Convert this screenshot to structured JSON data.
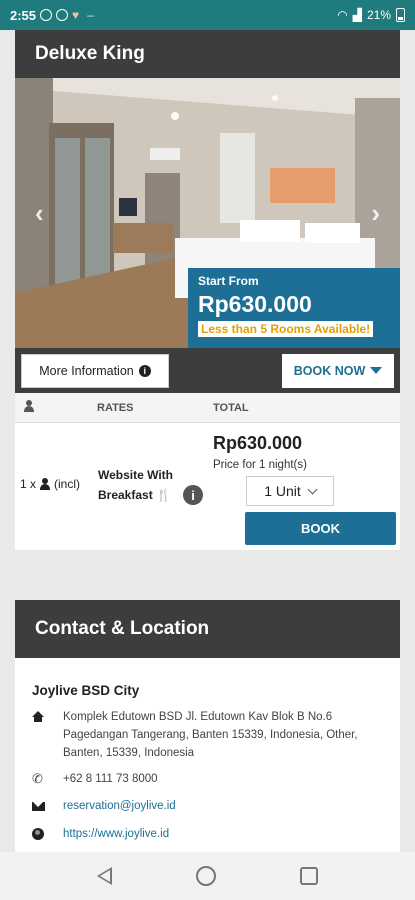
{
  "status_bar": {
    "time": "2:55",
    "battery": "21%"
  },
  "room": {
    "title": "Deluxe King",
    "price_label": "Start From",
    "price": "Rp630.000",
    "availability": "Less than 5 Rooms Available!",
    "more_info_label": "More Information",
    "book_now_label": "BOOK NOW"
  },
  "rates_table": {
    "headers": {
      "rates": "RATES",
      "total": "TOTAL"
    },
    "row": {
      "guests": "1 x",
      "guests_suffix": "(incl)",
      "rate_name": "Website With Breakfast",
      "total": "Rp630.000",
      "price_note": "Price for 1 night(s)",
      "unit_select": "1 Unit",
      "book_label": "BOOK"
    }
  },
  "contact": {
    "title": "Contact & Location",
    "hotel_name": "Joylive BSD City",
    "address": "Komplek Edutown BSD Jl. Edutown Kav Blok B No.6 Pagedangan Tangerang, Banten 15339, Indonesia, Other, Banten, 15339, Indonesia",
    "phone": "+62 8 111 73 8000",
    "email": "reservation@joylive.id",
    "website": "https://www.joylive.id"
  }
}
